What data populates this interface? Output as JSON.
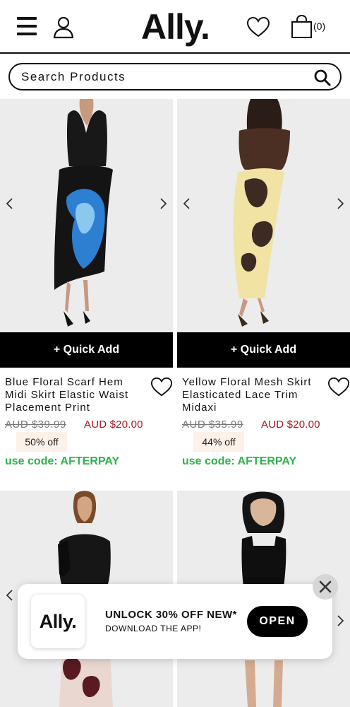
{
  "header": {
    "logo": "Ally.",
    "bag_count": "(0)"
  },
  "search": {
    "placeholder": "Search Products"
  },
  "products": [
    {
      "name": "Blue Floral Scarf Hem Midi Skirt Elastic Waist Placement Print",
      "quick_add": "+ Quick Add",
      "price_old": "AUD $39.99",
      "price_new": "AUD $20.00",
      "discount": "50% off",
      "code": "use code: AFTERPAY"
    },
    {
      "name": "Yellow Floral Mesh Skirt Elasticated Lace Trim Midaxi",
      "quick_add": "+ Quick Add",
      "price_old": "AUD $35.99",
      "price_new": "AUD $20.00",
      "discount": "44% off",
      "code": "use code: AFTERPAY"
    },
    {
      "name": "",
      "quick_add": "",
      "price_old": "",
      "price_new": "",
      "discount": "",
      "code": ""
    },
    {
      "name": "",
      "quick_add": "",
      "price_old": "",
      "price_new": "",
      "discount": "",
      "code": ""
    }
  ],
  "app_banner": {
    "logo": "Ally.",
    "title": "UNLOCK 30% OFF NEW*",
    "subtitle": "DOWNLOAD THE APP!",
    "open_label": "OPEN"
  },
  "colors": {
    "accent": "#000000",
    "sale_price": "#a3181f",
    "promo_code": "#2db34a",
    "discount_badge_bg": "#fdf1e9"
  },
  "icons": [
    "menu-icon",
    "account-icon",
    "heart-icon",
    "bag-icon",
    "search-icon",
    "chevron-left-icon",
    "chevron-right-icon",
    "close-icon"
  ]
}
